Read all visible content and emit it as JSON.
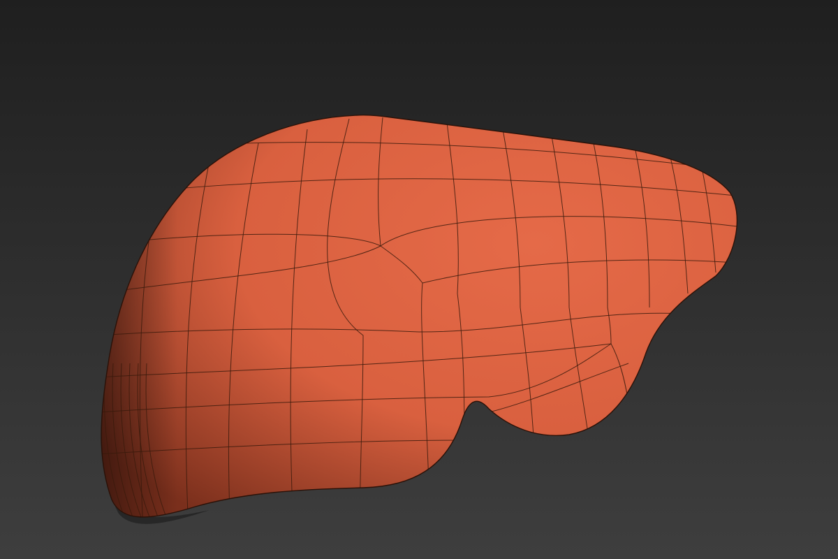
{
  "viewport": {
    "background_top": "#1f1f1f",
    "background_bottom": "#3e3e3e"
  },
  "model": {
    "object": "liver-mesh",
    "shading": "smooth",
    "wireframe_overlay": true,
    "surface_color": "#d9603f",
    "highlight_color": "#e56a48",
    "shadow_color": "#7a2f1c",
    "wire_color": "#3a1a0c"
  }
}
